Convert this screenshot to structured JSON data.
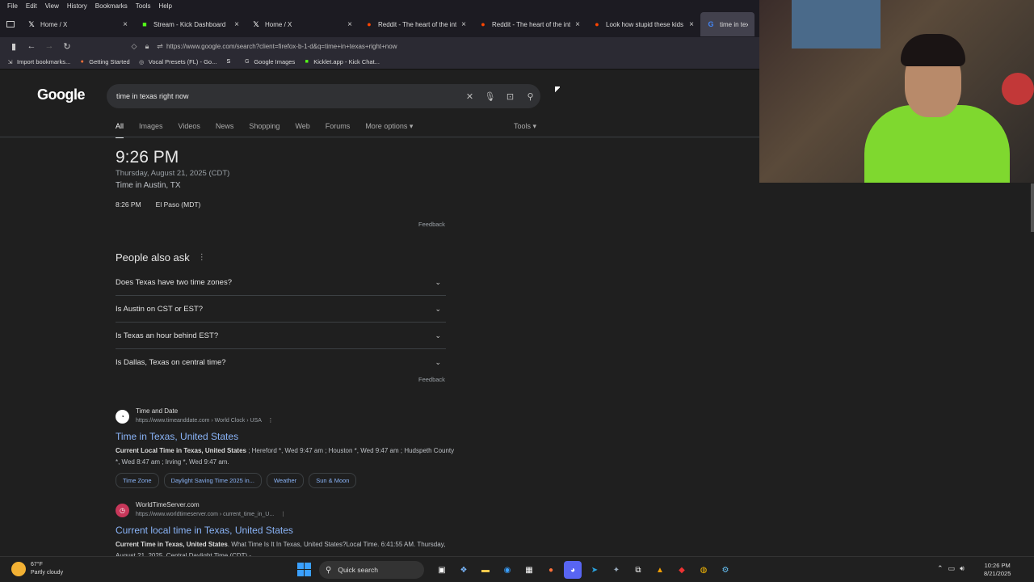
{
  "menu": [
    "File",
    "Edit",
    "View",
    "History",
    "Bookmarks",
    "Tools",
    "Help"
  ],
  "tabs": [
    {
      "label": "Home / X",
      "icon": "x-logo-icon",
      "glyph": "𝕏",
      "color": "#ffffff"
    },
    {
      "label": "Stream - Kick Dashboard",
      "icon": "kick-logo-icon",
      "glyph": "■",
      "color": "#53fc18"
    },
    {
      "label": "Home / X",
      "icon": "x-logo-icon",
      "glyph": "𝕏",
      "color": "#ffffff"
    },
    {
      "label": "Reddit - The heart of the intern",
      "icon": "reddit-icon",
      "glyph": "●",
      "color": "#ff4500"
    },
    {
      "label": "Reddit - The heart of the intern",
      "icon": "reddit-icon",
      "glyph": "●",
      "color": "#ff4500"
    },
    {
      "label": "Look how stupid these kids are",
      "icon": "reddit-icon",
      "glyph": "●",
      "color": "#ff4500"
    },
    {
      "label": "time in texas ri",
      "icon": "google-icon",
      "glyph": "G",
      "color": "#4285f4"
    }
  ],
  "url": "https://www.google.com/search?client=firefox-b-1-d&q=time+in+texas+right+now",
  "bookmarks": [
    {
      "label": "Import bookmarks...",
      "icon": "import-icon",
      "glyph": "⇲",
      "color": "#cccccc"
    },
    {
      "label": "Getting Started",
      "icon": "firefox-icon",
      "glyph": "●",
      "color": "#ff7139"
    },
    {
      "label": "Vocal Presets (FL) - Go...",
      "icon": "globe-icon",
      "glyph": "◎",
      "color": "#cccccc"
    },
    {
      "label": "",
      "icon": "s-logo-icon",
      "glyph": "S",
      "color": "#ffffff"
    },
    {
      "label": "Google Images",
      "icon": "google-icon",
      "glyph": "G",
      "color": "#cccccc"
    },
    {
      "label": "Kicklet.app - Kick Chat...",
      "icon": "kicklet-icon",
      "glyph": "■",
      "color": "#53fc18"
    }
  ],
  "google": {
    "logo": "Google",
    "query": "time in texas right now",
    "search_tabs": [
      "All",
      "Images",
      "Videos",
      "News",
      "Shopping",
      "Web",
      "Forums",
      "More options ▾"
    ],
    "tools": "Tools ▾"
  },
  "time_card": {
    "time": "9:26 PM",
    "date": "Thursday, August 21, 2025 (CDT)",
    "location": "Time in Austin, TX",
    "alt_time": "8:26 PM",
    "alt_place": "El Paso (MDT)",
    "feedback": "Feedback"
  },
  "paa": {
    "title": "People also ask",
    "items": [
      "Does Texas have two time zones?",
      "Is Austin on CST or EST?",
      "Is Texas an hour behind EST?",
      "Is Dallas, Texas on central time?"
    ],
    "feedback": "Feedback"
  },
  "results": [
    {
      "site": "Time and Date",
      "url": "https://www.timeanddate.com › World Clock › USA",
      "title": "Time in Texas, United States",
      "snippet_bold": "Current Local Time in Texas, United States",
      "snippet": " ; Hereford *, Wed 9:47 am ; Houston *, Wed 9:47 am ; Hudspeth County *, Wed 8:47 am ; Irving *, Wed 9:47 am.",
      "chips": [
        "Time Zone",
        "Daylight Saving Time 2025 in...",
        "Weather",
        "Sun & Moon"
      ]
    },
    {
      "site": "WorldTimeServer.com",
      "url": "https://www.worldtimeserver.com › current_time_in_U...",
      "title": "Current local time in Texas, United States",
      "snippet_bold": "Current Time in Texas, United States",
      "snippet": ". What Time Is It In Texas, United States?Local Time. 6:41:55 AM. Thursday, August 21, 2025. Central Daylight Time (CDT) - ..."
    }
  ],
  "taskbar": {
    "temp": "67°F",
    "weather": "Partly cloudy",
    "search": "Quick search",
    "time": "10:26 PM",
    "date": "8/21/2025"
  }
}
